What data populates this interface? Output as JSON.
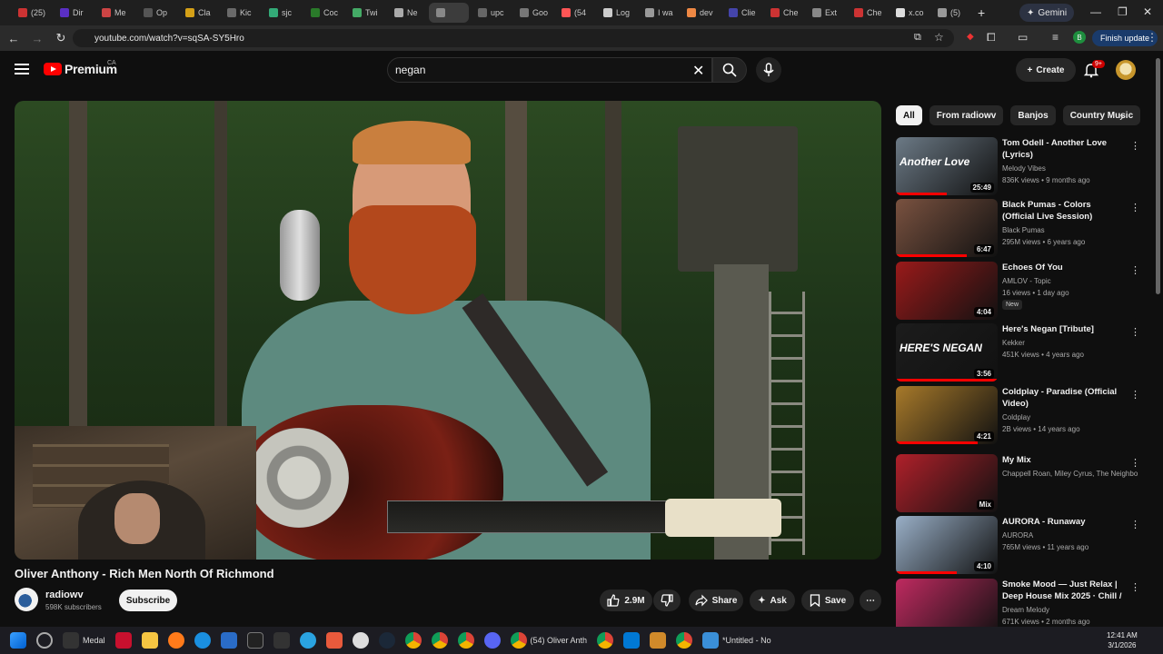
{
  "browser": {
    "tabs": [
      "(25)",
      "Dir",
      "Me",
      "Op",
      "Cla",
      "Kic",
      "sjc",
      "Coc",
      "Twi",
      "Ne",
      "",
      "upc",
      "Goo",
      "(54",
      "Log",
      "I wa",
      "dev",
      "Clie",
      "Che",
      "Ext",
      "Che",
      "x.co",
      "(5)"
    ],
    "gemini_label": "Gemini",
    "url": "youtube.com/watch?v=sqSA-SY5Hro",
    "finish_update": "Finish update",
    "profile_letter": "B"
  },
  "youtube": {
    "logo_word": "Premium",
    "country": "CA",
    "search_value": "negan",
    "create_label": "Create",
    "notif_badge": "9+"
  },
  "video": {
    "title": "Oliver Anthony - Rich Men North Of Richmond",
    "channel": "radiowv",
    "subscribers": "598K subscribers",
    "subscribe_label": "Subscribe",
    "likes": "2.9M",
    "share_label": "Share",
    "ask_label": "Ask",
    "save_label": "Save"
  },
  "chips": [
    "All",
    "From radiowv",
    "Banjos",
    "Country Music"
  ],
  "recommendations": [
    {
      "title": "Tom Odell - Another Love (Lyrics)",
      "channel": "Melody Vibes",
      "stats": "836K views • 9 months ago",
      "duration": "25:49",
      "thumb_text": "Another Love",
      "thumb_color": "#6c7a86",
      "progress": 0.5
    },
    {
      "title": "Black Pumas - Colors (Official Live Session)",
      "channel": "Black Pumas",
      "stats": "295M views • 6 years ago",
      "duration": "6:47",
      "thumb_color": "#7a5240",
      "progress": 0.7
    },
    {
      "title": "Echoes Of You",
      "channel": "AMLOV - Topic",
      "stats": "16 views • 1 day ago",
      "duration": "4:04",
      "badge": "New",
      "thumb_color": "#9a1a1a",
      "progress": 0
    },
    {
      "title": "Here's Negan [Tribute]",
      "channel": "Kekker",
      "stats": "451K views • 4 years ago",
      "duration": "3:56",
      "thumb_text": "HERE'S NEGAN",
      "thumb_color": "#1c1c1c",
      "progress": 1.0
    },
    {
      "title": "Coldplay - Paradise (Official Video)",
      "channel": "Coldplay",
      "stats": "2B views • 14 years ago",
      "duration": "4:21",
      "thumb_color": "#a87a2a",
      "progress": 0.8
    },
    {
      "title": "My Mix",
      "channel": "Chappell Roan, Miley Cyrus, The Neighbo...",
      "stats": "",
      "duration": "Mix",
      "thumb_color": "#b0202a",
      "progress": 0
    },
    {
      "title": "AURORA - Runaway",
      "channel": "AURORA",
      "stats": "765M views • 11 years ago",
      "duration": "4:10",
      "thumb_color": "#9ab0c8",
      "progress": 0.6
    },
    {
      "title": "Smoke Mood — Just Relax | Deep House Mix 2025 · Chill / ...",
      "channel": "Dream Melody",
      "stats": "671K views • 2 months ago",
      "duration": "",
      "thumb_color": "#c02a60",
      "progress": 0
    }
  ],
  "taskbar": {
    "medal_label": "Medal",
    "chrome_window": "(54) Oliver Anth",
    "notepad_window": "*Untitled - No",
    "time": "12:41 AM",
    "date": "3/1/2026"
  }
}
